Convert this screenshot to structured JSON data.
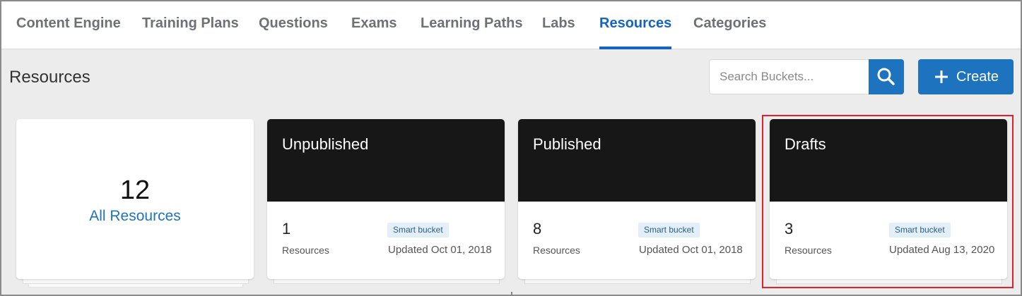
{
  "nav": {
    "tabs": [
      {
        "label": "Content Engine",
        "active": false
      },
      {
        "label": "Training Plans",
        "active": false
      },
      {
        "label": "Questions",
        "active": false
      },
      {
        "label": "Exams",
        "active": false
      },
      {
        "label": "Learning Paths",
        "active": false
      },
      {
        "label": "Labs",
        "active": false
      },
      {
        "label": "Resources",
        "active": true
      },
      {
        "label": "Categories",
        "active": false
      }
    ]
  },
  "page": {
    "title": "Resources"
  },
  "search": {
    "placeholder": "Search Buckets...",
    "value": "",
    "icon": "search-icon"
  },
  "create": {
    "label": "Create",
    "icon": "plus-icon"
  },
  "all_resources": {
    "count": "12",
    "label": "All Resources"
  },
  "buckets": [
    {
      "title": "Unpublished",
      "count": "1",
      "count_label": "Resources",
      "badge": "Smart bucket",
      "updated": "Updated Oct 01, 2018"
    },
    {
      "title": "Published",
      "count": "8",
      "count_label": "Resources",
      "badge": "Smart bucket",
      "updated": "Updated Oct 01, 2018"
    },
    {
      "title": "Drafts",
      "count": "3",
      "count_label": "Resources",
      "badge": "Smart bucket",
      "updated": "Updated Aug 13, 2020",
      "highlighted": true
    }
  ],
  "colors": {
    "accent": "#1e73be",
    "active_tab": "#1565c0",
    "card_header": "#171717",
    "highlight": "#e0202a"
  }
}
